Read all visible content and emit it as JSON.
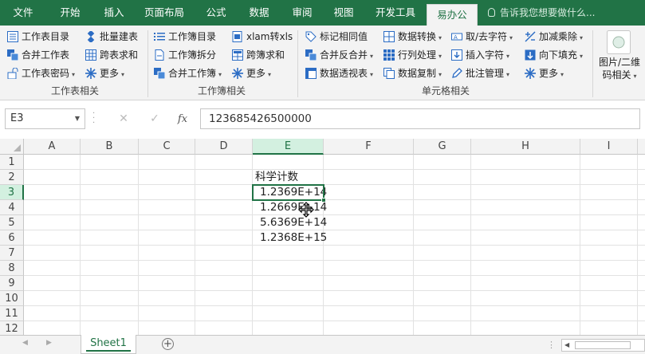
{
  "ribbon_tabs": [
    "文件",
    "开始",
    "插入",
    "页面布局",
    "公式",
    "数据",
    "审阅",
    "视图",
    "开发工具",
    "易办公"
  ],
  "active_tab": "易办公",
  "tellme": "告诉我您想要做什么...",
  "groups": {
    "worksheet": {
      "label": "工作表相关",
      "items": [
        "工作表目录",
        "批量建表",
        "合并工作表",
        "跨表求和",
        "工作表密码",
        "更多"
      ]
    },
    "workbook": {
      "label": "工作簿相关",
      "items": [
        "工作簿目录",
        "xlam转xls",
        "工作簿拆分",
        "跨簿求和",
        "合并工作簿",
        "更多"
      ]
    },
    "cell": {
      "label": "单元格相关",
      "items": [
        "标记相同值",
        "数据转换",
        "取/去字符",
        "加减乘除",
        "合并反合并",
        "行列处理",
        "插入字符",
        "向下填充",
        "数据透视表",
        "数据复制",
        "批注管理",
        "更多"
      ]
    },
    "qr": {
      "line1": "图片/二维",
      "line2": "码相关"
    }
  },
  "formula_bar": {
    "name_box": "E3",
    "fx": "fx",
    "formula": "123685426500000"
  },
  "columns": [
    "A",
    "B",
    "C",
    "D",
    "E",
    "F",
    "G",
    "H",
    "I"
  ],
  "rows": [
    "1",
    "2",
    "3",
    "4",
    "5",
    "6",
    "7",
    "8",
    "9",
    "10",
    "11",
    "12"
  ],
  "cells": {
    "E2": "科学计数",
    "E3": "1.2369E+14",
    "E4": "1.2669E+14",
    "E5": "5.6369E+14",
    "E6": "1.2368E+15"
  },
  "sheets": [
    "Sheet1"
  ],
  "colors": {
    "excel_green": "#217346",
    "ribbon_bg": "#f3f3f3",
    "icon_blue": "#2b6cc4"
  }
}
